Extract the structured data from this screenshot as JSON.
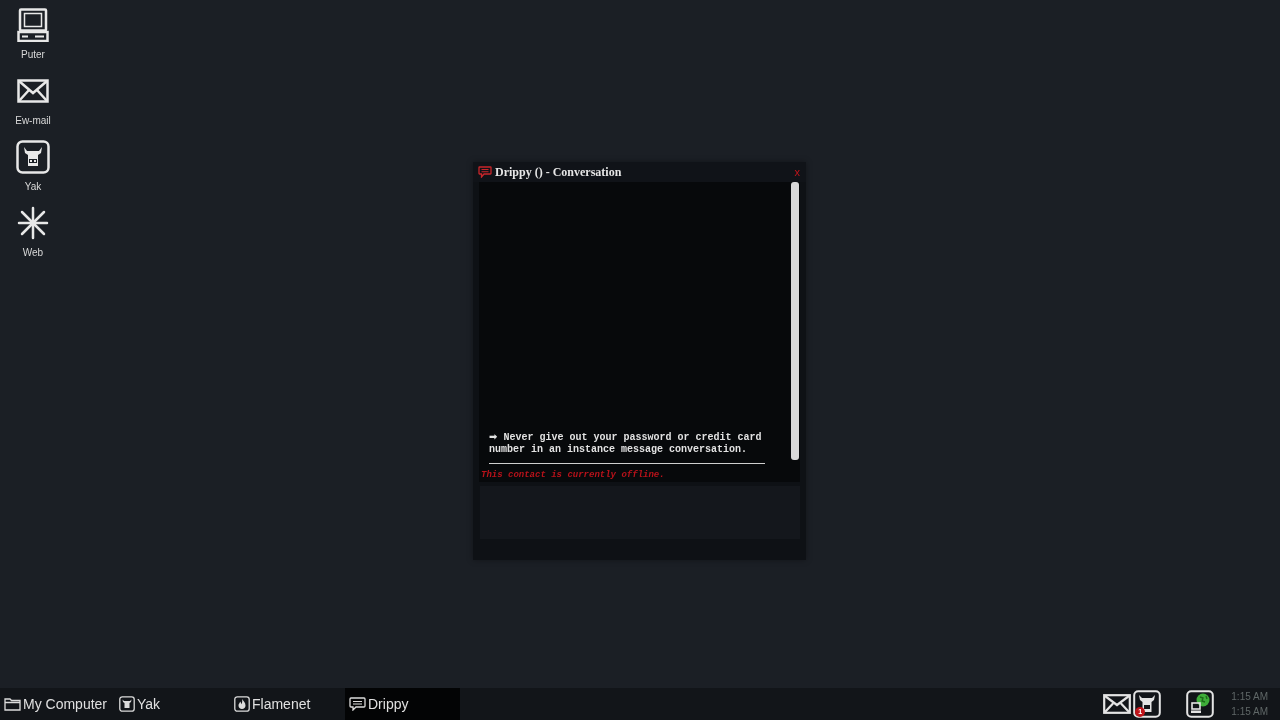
{
  "desktop_icons": [
    {
      "label": "Puter",
      "kind": "computer"
    },
    {
      "label": "Ew-mail",
      "kind": "mail"
    },
    {
      "label": "Yak",
      "kind": "yak"
    },
    {
      "label": "Web",
      "kind": "web"
    }
  ],
  "window": {
    "title": "Drippy () - Conversation",
    "close": "x",
    "notice": "➡ Never give out your password or credit card number in an instance message conversation.",
    "status": "This contact is currently offline."
  },
  "taskbar": {
    "items": [
      {
        "label": "My Computer",
        "kind": "folder",
        "selected": false
      },
      {
        "label": "Yak",
        "kind": "yak",
        "selected": false
      },
      {
        "label": "Flamenet",
        "kind": "flamenet",
        "selected": false
      },
      {
        "label": "Drippy",
        "kind": "chat",
        "selected": true
      }
    ],
    "tray": [
      {
        "kind": "mail"
      },
      {
        "kind": "yak",
        "badge": "1"
      },
      {
        "kind": "network"
      }
    ],
    "clock": [
      "1:15 AM",
      "1:15 AM"
    ]
  }
}
